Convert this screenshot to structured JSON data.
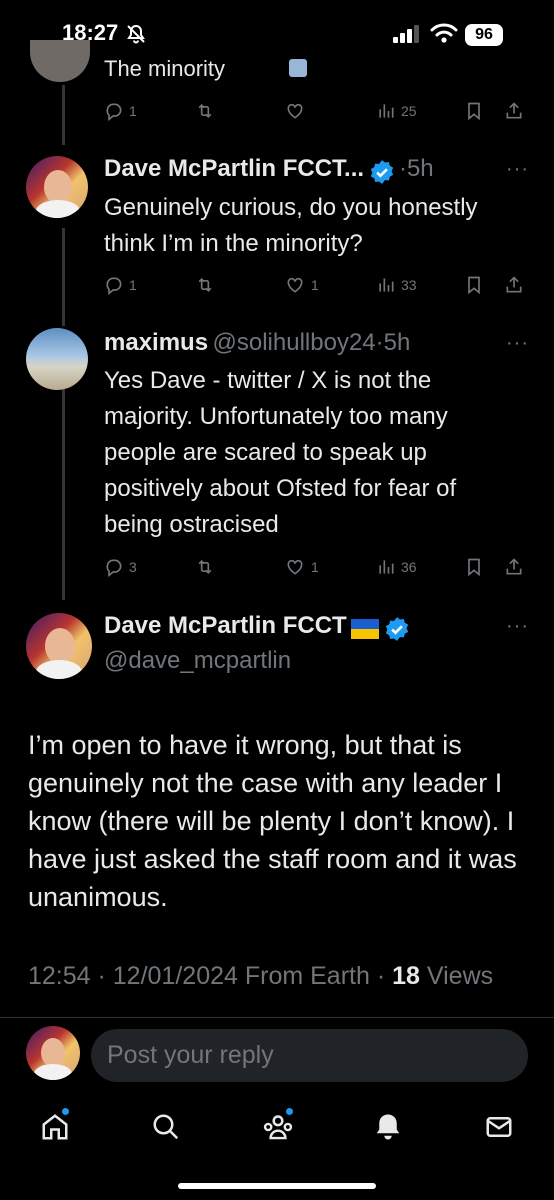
{
  "status_bar": {
    "time": "18:27",
    "battery": "96"
  },
  "prev_tweet": {
    "text_fragment": "The minority",
    "replies": "1",
    "views": "25"
  },
  "tweet1": {
    "name": "Dave McPartlin FCCT...",
    "time": "·5h",
    "text": "Genuinely curious, do you honestly think I’m in the minority?",
    "replies": "1",
    "likes": "1",
    "views": "33"
  },
  "tweet2": {
    "name": "maximus",
    "handle": "@solihullboy24",
    "time": "·5h",
    "text": "Yes Dave - twitter / X is not the majority. Unfortunately too many people are scared to speak up positively about Ofsted for fear of being ostracised",
    "replies": "3",
    "likes": "1",
    "views": "36"
  },
  "main_tweet": {
    "name": "Dave McPartlin FCCT",
    "handle": "@dave_mcpartlin",
    "text": "I’m open to have it wrong, but that is genuinely not the case with any leader I know (there will be plenty I don’t know). I have just asked the staff room and it was unanimous.",
    "time_date": "12:54 · 12/01/2024",
    "source": "From Earth",
    "sep": "·",
    "views_count": "18",
    "views_label": "Views"
  },
  "reply": {
    "placeholder": "Post your reply"
  },
  "more_label": "···",
  "colors": {
    "accent": "#1d9bf0",
    "muted": "#71767b",
    "text": "#e7e9ea",
    "background": "#000000"
  },
  "icons": [
    "bell-slash-icon",
    "signal-icon",
    "wifi-icon",
    "reply-icon",
    "retweet-icon",
    "like-icon",
    "views-icon",
    "bookmark-icon",
    "share-icon",
    "verified-icon",
    "ukraine-flag-icon",
    "home-icon",
    "search-icon",
    "communities-icon",
    "notifications-icon",
    "messages-icon"
  ]
}
